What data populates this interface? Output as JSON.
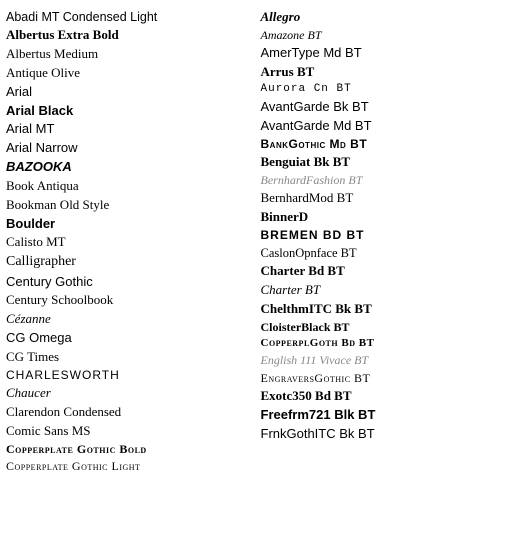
{
  "left_column": [
    {
      "text": "Abadi MT Condensed Light",
      "class": "f-abadi"
    },
    {
      "text": "Albertus Extra Bold",
      "class": "f-albertus-bold"
    },
    {
      "text": "Albertus Medium",
      "class": "f-albertus-med"
    },
    {
      "text": "Antique Olive",
      "class": "f-antique"
    },
    {
      "text": "Arial",
      "class": "f-arial"
    },
    {
      "text": "Arial Black",
      "class": "f-arial-black"
    },
    {
      "text": "Arial MT",
      "class": "f-arial-mt"
    },
    {
      "text": "Arial Narrow",
      "class": "f-arial-narrow"
    },
    {
      "text": "BAZOOKA",
      "class": "f-bazooka"
    },
    {
      "text": "Book Antiqua",
      "class": "f-book-antiqua"
    },
    {
      "text": "Bookman Old Style",
      "class": "f-bookman"
    },
    {
      "text": "Boulder",
      "class": "f-boulder"
    },
    {
      "text": "Calisto MT",
      "class": "f-calisto"
    },
    {
      "text": "Calligrapher",
      "class": "f-calligrapher"
    },
    {
      "text": "Century Gothic",
      "class": "f-century-gothic"
    },
    {
      "text": "Century Schoolbook",
      "class": "f-century-schoolbook"
    },
    {
      "text": "Cézanne",
      "class": "f-cezanne"
    },
    {
      "text": "CG Omega",
      "class": "f-cg-omega"
    },
    {
      "text": "CG Times",
      "class": "f-cg-times"
    },
    {
      "text": "CHARLESWORTH",
      "class": "f-charlesworth"
    },
    {
      "text": "Chaucer",
      "class": "f-chaucer"
    },
    {
      "text": "Clarendon Condensed",
      "class": "f-clarendon"
    },
    {
      "text": "Comic Sans MS",
      "class": "f-comic-sans"
    },
    {
      "text": "Copperplate Gothic Bold",
      "class": "f-copperplate-bold"
    },
    {
      "text": "Copperplate Gothic Light",
      "class": "f-copperplate-light"
    }
  ],
  "right_column": [
    {
      "text": "Allegro",
      "class": "f-allegro"
    },
    {
      "text": "Amazone BT",
      "class": "f-amazone"
    },
    {
      "text": "AmerType Md BT",
      "class": "f-amertype"
    },
    {
      "text": "Arrus BT",
      "class": "f-arrus"
    },
    {
      "text": "Aurora Cn BT",
      "class": "f-aurora"
    },
    {
      "text": "AvantGarde Bk BT",
      "class": "f-avantgarde-bk"
    },
    {
      "text": "AvantGarde Md BT",
      "class": "f-avantgarde-md"
    },
    {
      "text": "BankGothic Md BT",
      "class": "f-bankgothic"
    },
    {
      "text": "Benguiat Bk BT",
      "class": "f-benguiat"
    },
    {
      "text": "BernhardFashion BT",
      "class": "f-bernhard-fashion"
    },
    {
      "text": "BernhardMod BT",
      "class": "f-bernhard-mod"
    },
    {
      "text": "BinnerD",
      "class": "f-binnerd"
    },
    {
      "text": "BREMEN BD BT",
      "class": "f-bremen"
    },
    {
      "text": "CaslonOpnface BT",
      "class": "f-caslon"
    },
    {
      "text": "Charter Bd BT",
      "class": "f-charter-bd"
    },
    {
      "text": "Charter BT",
      "class": "f-charter"
    },
    {
      "text": "ChelthmITC Bk BT",
      "class": "f-chelthmitc"
    },
    {
      "text": "CloisterBlack BT",
      "class": "f-cloisterblack"
    },
    {
      "text": "CopperplGoth Bd BT",
      "class": "f-copperpgoth"
    },
    {
      "text": "English 111 Vivace BT",
      "class": "f-english111"
    },
    {
      "text": "EngraversGothic BT",
      "class": "f-engravers"
    },
    {
      "text": "Exotc350 Bd BT",
      "class": "f-exotc350"
    },
    {
      "text": "Freefrm721 Blk BT",
      "class": "f-freefrm"
    },
    {
      "text": "FrnkGothITC Bk BT",
      "class": "f-frnkgothitc"
    }
  ]
}
